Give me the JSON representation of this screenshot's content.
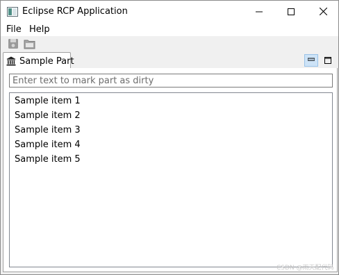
{
  "window": {
    "title": "Eclipse RCP Application",
    "icons": {
      "app": "app-window-icon",
      "minimize": "minimize-icon",
      "maximize": "maximize-icon",
      "close": "close-icon"
    }
  },
  "menubar": {
    "items": [
      {
        "label": "File"
      },
      {
        "label": "Help"
      }
    ]
  },
  "toolbar": {
    "buttons": [
      {
        "icon": "save-icon"
      },
      {
        "icon": "open-folder-icon"
      }
    ]
  },
  "part": {
    "tab_label": "Sample Part",
    "tab_icon": "museum-icon",
    "view_buttons": [
      "minimize-view-icon",
      "maximize-view-icon"
    ],
    "input": {
      "value": "",
      "placeholder": "Enter text to mark part as dirty"
    },
    "list_items": [
      "Sample item 1",
      "Sample item 2",
      "Sample item 3",
      "Sample item 4",
      "Sample item 5"
    ]
  },
  "watermark": "CSDN @雨天配代码",
  "colors": {
    "accent_selected_button": "#cde3f7",
    "border": "#a0a0a0",
    "toolbar_bg": "#f0f0f0"
  }
}
